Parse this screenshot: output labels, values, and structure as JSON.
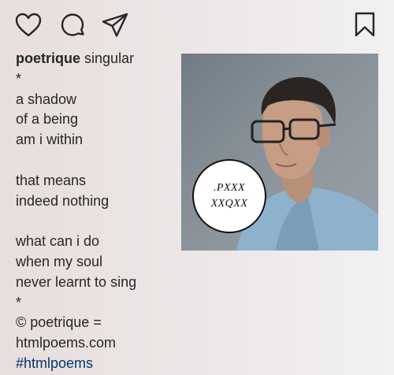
{
  "actions": {
    "like_icon": "heart-outline-icon",
    "comment_icon": "speech-bubble-icon",
    "share_icon": "paper-plane-icon",
    "save_icon": "bookmark-icon"
  },
  "caption": {
    "username": "poetrique",
    "title": "singular",
    "lines": [
      "*",
      "a shadow",
      "of a being",
      "am i within",
      "",
      "that means",
      "indeed nothing",
      "",
      "what can i do",
      "when my soul",
      "never learnt to sing",
      "*",
      "© poetrique =",
      "htmlpoems.com"
    ],
    "hashtag": "#htmlpoems"
  },
  "post_image": {
    "stamp_line1": ".PXXX",
    "stamp_line2": "XXQXX"
  },
  "colors": {
    "text": "#262626",
    "hashtag": "#00376b",
    "photo_bg": "#8c969e"
  }
}
